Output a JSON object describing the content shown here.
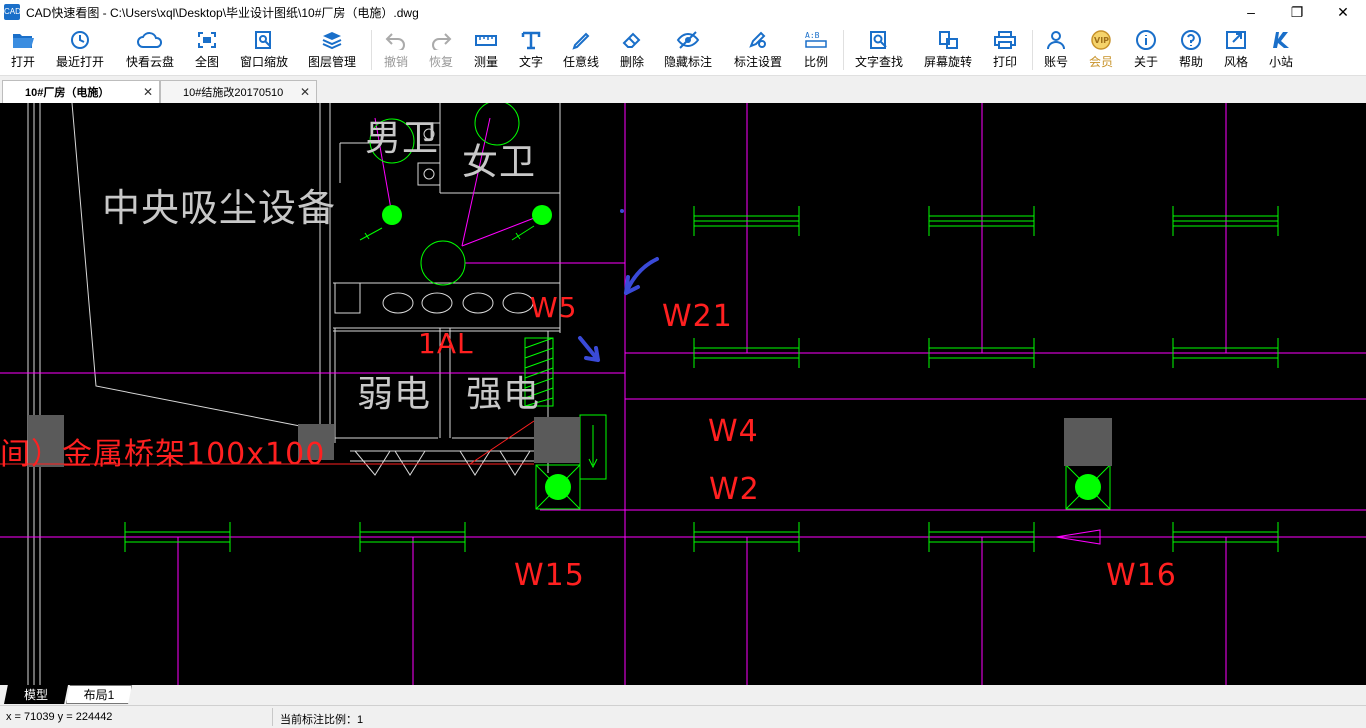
{
  "window": {
    "icon_text": "CAD",
    "title": "CAD快速看图 - C:\\Users\\xql\\Desktop\\毕业设计图纸\\10#厂房（电施）.dwg",
    "minimize": "–",
    "restore": "❐",
    "close": "✕"
  },
  "toolbar": {
    "open": "打开",
    "recent": "最近打开",
    "cloud": "快看云盘",
    "fit": "全图",
    "window_zoom": "窗口缩放",
    "layers": "图层管理",
    "undo": "撤销",
    "redo": "恢复",
    "measure": "测量",
    "text": "文字",
    "freeline": "任意线",
    "erase": "删除",
    "hide_marks": "隐藏标注",
    "mark_settings": "标注设置",
    "ratio": "比例",
    "text_search": "文字查找",
    "rotate": "屏幕旋转",
    "print": "打印",
    "account": "账号",
    "member": "会员",
    "about": "关于",
    "help": "帮助",
    "style": "风格",
    "station": "小站"
  },
  "tabs": [
    {
      "label": "10#厂房（电施）",
      "active": true
    },
    {
      "label": "10#结施改20170510",
      "active": false
    }
  ],
  "drawing": {
    "central_vacuum": "中央吸尘设备",
    "room_a": "男卫",
    "room_b": "女卫",
    "label_1al": "1AL",
    "weak": "弱电",
    "strong": "强电",
    "cable_tray": "间）金属桥架100x100",
    "w5": "W5",
    "w21": "W21",
    "w4": "W4",
    "w2": "W2",
    "w15": "W15",
    "w16": "W16"
  },
  "layout_tabs": [
    {
      "label": "模型",
      "active": true
    },
    {
      "label": "布局1",
      "active": false
    }
  ],
  "status": {
    "coords": "x = 71039  y = 224442",
    "scale": "当前标注比例：1"
  },
  "colors": {
    "canvas_bg": "#000000",
    "cad_white": "#d8d8d8",
    "cad_magenta": "#ff00ff",
    "cad_green": "#00ff00",
    "cad_red": "#ff2020",
    "cad_gray": "#5a5a5a",
    "annotation_blue": "#3a4ad8",
    "toolbar_icon": "#1a6fc9"
  }
}
